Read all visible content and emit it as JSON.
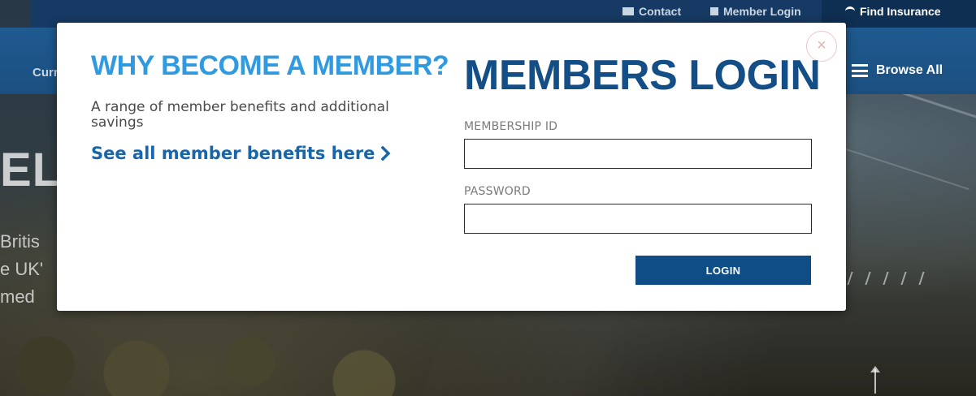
{
  "site": {
    "top_links": {
      "contact": "Contact",
      "member_login": "Member Login",
      "find_insurance": "Find Insurance"
    },
    "nav_left_text": "Curr",
    "browse_all": "Browse All",
    "hero_big_text": "ELC",
    "hero_lines": [
      "Britis",
      "e UK'",
      "med"
    ]
  },
  "modal": {
    "close_symbol": "×",
    "left": {
      "title": "WHY BECOME A MEMBER?",
      "description": "A range of member benefits and additional savings",
      "link_text": "See all member benefits here"
    },
    "right": {
      "title": "MEMBERS LOGIN",
      "membership_label": "MEMBERSHIP ID",
      "membership_value": "",
      "password_label": "PASSWORD",
      "password_value": "",
      "login_button": "LOGIN"
    }
  },
  "colors": {
    "accent_light_blue": "#2f9ae0",
    "brand_dark_blue": "#144e86",
    "button_blue": "#0f4d86",
    "link_blue": "#1866a9"
  },
  "icons": {
    "contact": "envelope-icon",
    "member_login": "user-card-icon",
    "find_insurance": "umbrella-icon",
    "browse_all": "hamburger-menu-icon",
    "benefits_link": "chevron-right-icon",
    "close": "close-icon"
  }
}
